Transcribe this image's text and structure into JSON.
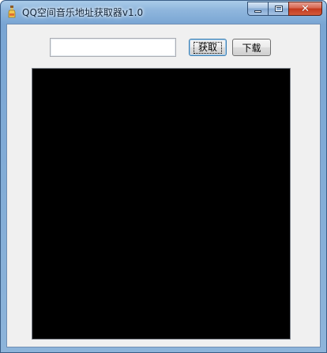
{
  "window": {
    "title": "QQ空间音乐地址获取器v1.0",
    "icon": "bottle-app-icon",
    "caption_buttons": {
      "minimize": "—",
      "maximize": "□",
      "close": "✕"
    }
  },
  "toolbar": {
    "url_input_value": "",
    "url_input_placeholder": "",
    "fetch_label": "获取",
    "download_label": "下载"
  },
  "output": {
    "content": "",
    "background": "#000000"
  }
}
